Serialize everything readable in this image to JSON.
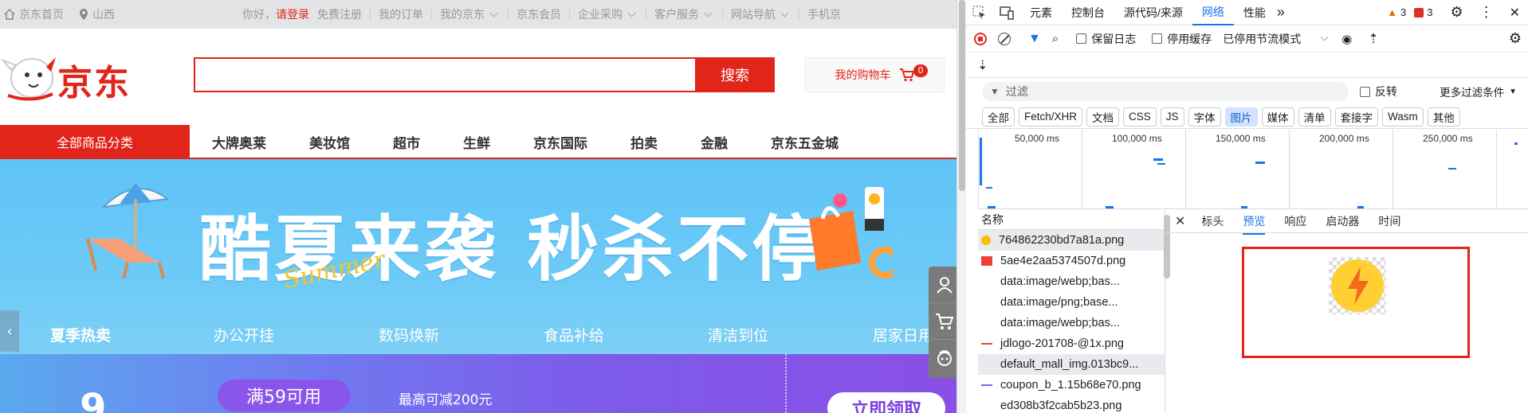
{
  "page": {
    "topbar": {
      "home": "京东首页",
      "location": "山西",
      "greeting": "你好，",
      "login": "请登录",
      "register": "免费注册",
      "links": [
        "我的订单",
        "我的京东",
        "京东会员",
        "企业采购",
        "客户服务",
        "网站导航",
        "手机京"
      ]
    },
    "logo_text": "京东",
    "search": {
      "placeholder": "",
      "button": "搜索"
    },
    "cart": {
      "label": "我的购物车",
      "count": "0"
    },
    "nav": {
      "category_button": "全部商品分类",
      "items": [
        "大牌奥莱",
        "美妆馆",
        "超市",
        "生鲜",
        "京东国际",
        "拍卖",
        "金融",
        "京东五金城"
      ]
    },
    "banner": {
      "title": "酷夏来袭 秒杀不停",
      "script_text": "Summer",
      "tabs": [
        "夏季热卖",
        "办公开挂",
        "数码焕新",
        "食品补给",
        "清洁到位",
        "居家日用"
      ]
    },
    "promo": {
      "big_number": "9",
      "threshold": "满59可用",
      "max_discount": "最高可减200元",
      "claim_button": "立即领取"
    }
  },
  "devtools": {
    "tabs": [
      "元素",
      "控制台",
      "源代码/来源",
      "网络",
      "性能"
    ],
    "active_tab": "网络",
    "warnings": "3",
    "errors": "3",
    "toolbar": {
      "preserve_log": "保留日志",
      "disable_cache": "停用缓存",
      "throttle": "已停用节流模式"
    },
    "filter": {
      "placeholder": "过滤",
      "invert": "反转",
      "more_filters": "更多过滤条件"
    },
    "type_chips": [
      "全部",
      "Fetch/XHR",
      "文档",
      "CSS",
      "JS",
      "字体",
      "图片",
      "媒体",
      "清单",
      "套接字",
      "Wasm",
      "其他"
    ],
    "active_chip": "图片",
    "timeline_labels": [
      "50,000 ms",
      "100,000 ms",
      "150,000 ms",
      "200,000 ms",
      "250,000 ms"
    ],
    "list_header": "名称",
    "requests": [
      "764862230bd7a81a.png",
      "5ae4e2aa5374507d.png",
      "data:image/webp;bas...",
      "data:image/png;base...",
      "data:image/webp;bas...",
      "jdlogo-201708-@1x.png",
      "default_mall_img.013bc9...",
      "coupon_b_1.15b68e70.png",
      "ed308b3f2cab5b23.png"
    ],
    "detail_tabs": [
      "标头",
      "预览",
      "响应",
      "启动器",
      "时间"
    ],
    "active_detail_tab": "预览"
  },
  "colors": {
    "jd_red": "#e1251b",
    "devtools_blue": "#1a73e8"
  }
}
